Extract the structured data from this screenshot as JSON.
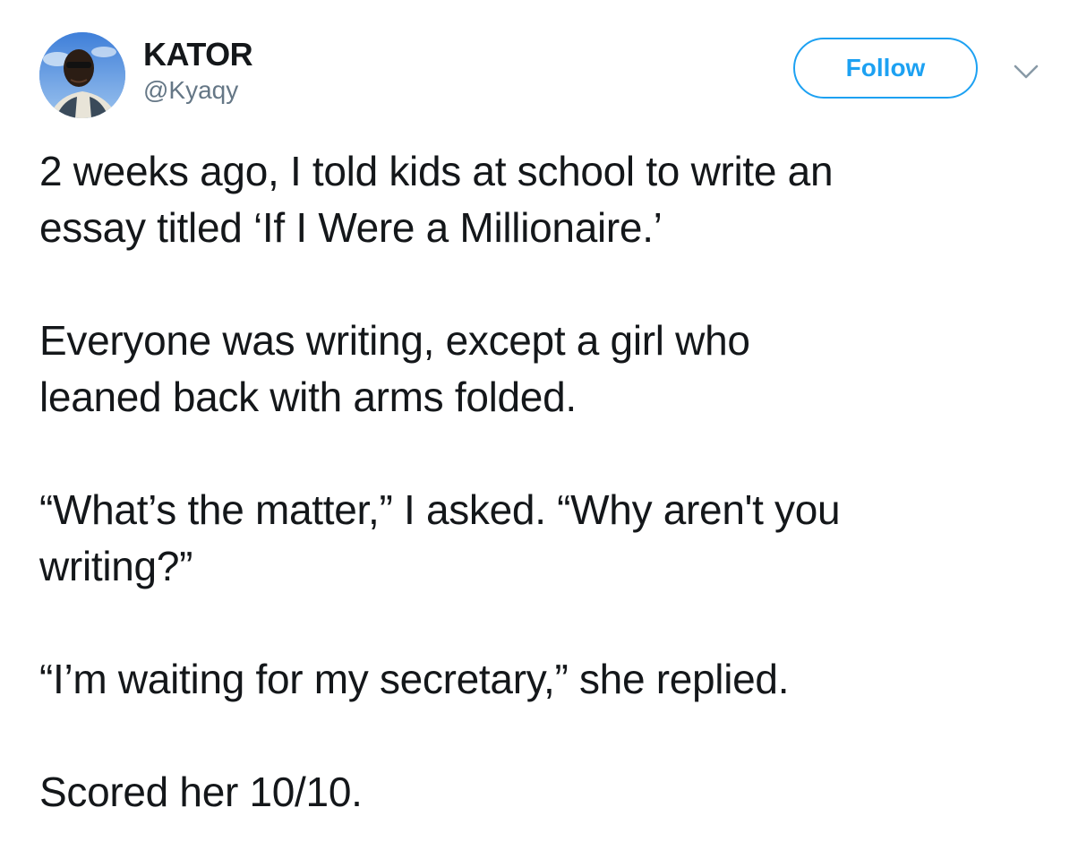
{
  "author": {
    "display_name": "KATOR",
    "username": "@Kyaqy"
  },
  "follow_button": {
    "label": "Follow"
  },
  "colors": {
    "accent": "#1da1f2",
    "text": "#14171a",
    "secondary_text": "#657786"
  },
  "icons": {
    "menu": "chevron-down-icon",
    "avatar": "profile-photo"
  },
  "tweet": {
    "paragraphs": [
      "2 weeks ago, I told kids at school to write an\nessay titled ‘If I Were a Millionaire.’",
      "Everyone was writing, except a girl who\nleaned back with arms folded.",
      "“What’s the matter,” I asked. “Why aren't you\nwriting?”",
      "“I’m waiting for my secretary,” she replied.",
      "Scored her 10/10."
    ]
  }
}
